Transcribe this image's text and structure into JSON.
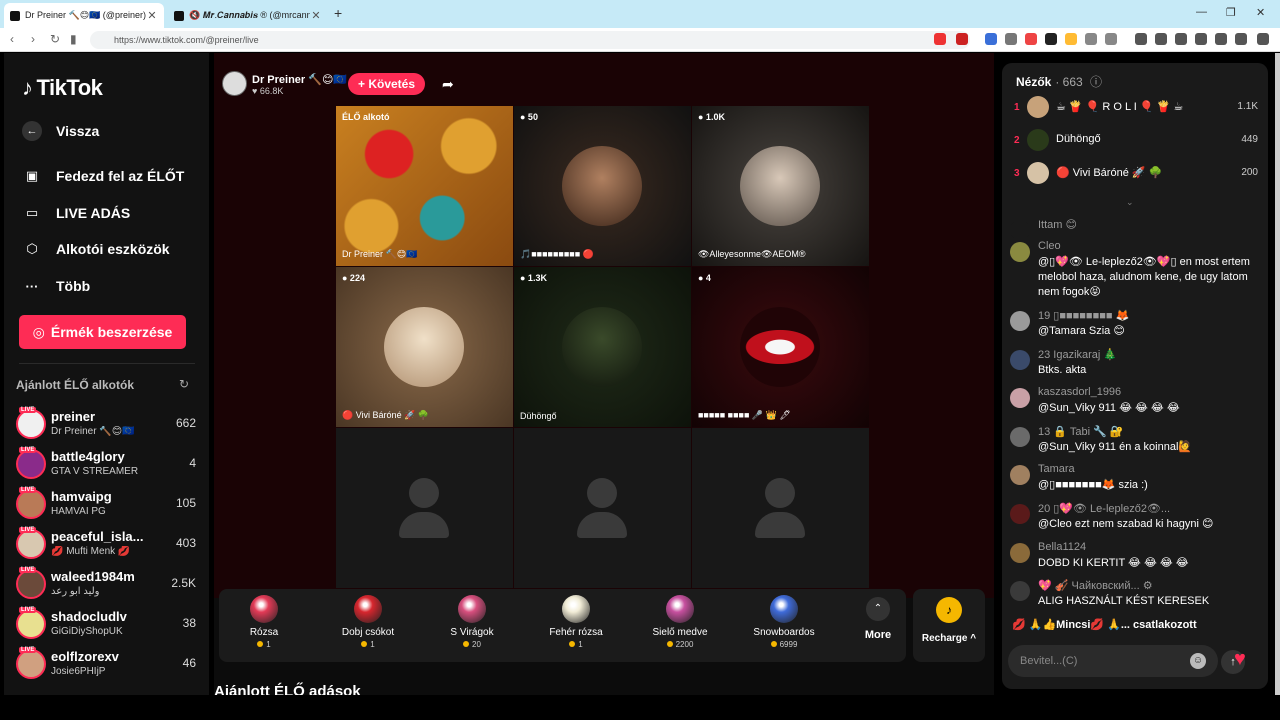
{
  "browser": {
    "tabs": [
      {
        "title": "Dr Preiner 🔨😊🇪🇺 (@preiner)"
      },
      {
        "title": "🔇 𝑴𝒓.𝑪𝒂𝒏𝒏𝒂𝒃𝒊𝒔 ® (@mrcannab"
      }
    ],
    "url": "https://www.tiktok.com/@preiner/live"
  },
  "sidebar": {
    "logo": "TikTok",
    "nav": [
      {
        "label": "Vissza"
      },
      {
        "label": "Fedezd fel az ÉLŐT"
      },
      {
        "label": "LIVE ADÁS"
      },
      {
        "label": "Alkotói eszközök"
      },
      {
        "label": "Több"
      }
    ],
    "coins_button": "Érmék beszerzése",
    "recommended_title": "Ajánlott ÉLŐ alkotók",
    "creators": [
      {
        "name": "preiner",
        "sub": "Dr Preiner 🔨😊🇪🇺",
        "count": "662",
        "color": "#f0f0f0"
      },
      {
        "name": "battle4glory",
        "sub": "GTA V STREAMER",
        "count": "4",
        "color": "#8a2b8a"
      },
      {
        "name": "hamvaipg",
        "sub": "HAMVAI PG",
        "count": "105",
        "color": "#b97a57"
      },
      {
        "name": "peaceful_isla...",
        "sub": "💋 Mufti Menk 💋",
        "count": "403",
        "color": "#d8c8b0"
      },
      {
        "name": "waleed1984m",
        "sub": "وليد ابو رعد",
        "count": "2.5K",
        "color": "#6b4a3a"
      },
      {
        "name": "shadocludlv",
        "sub": "GiGiDiyShopUK",
        "count": "38",
        "color": "#e8e090"
      },
      {
        "name": "eolflzorexv",
        "sub": "Josie6PHIjP",
        "count": "46",
        "color": "#d0a080"
      }
    ]
  },
  "host": {
    "name": "Dr Preiner 🔨😊🇪🇺",
    "likes": "♥ 66.8K",
    "follow_label": "+ Követés"
  },
  "grid": [
    {
      "badge": "ÉLŐ alkotó",
      "caption": "Dr Preiner 🔨😊🇪🇺"
    },
    {
      "badge": "● 50",
      "caption": "🎵■■■■■■■■■ 🔴"
    },
    {
      "badge": "● 1.0K",
      "caption": "👁Alleyesonme👁AEOM®"
    },
    {
      "badge": "● 224",
      "caption": "🔴 Vivi Báróné 🚀 🌳"
    },
    {
      "badge": "● 1.3K",
      "caption": "Dühöngő"
    },
    {
      "badge": "● 4",
      "caption": "■■■■■ ■■■■ 🎤 👑 🖊"
    }
  ],
  "gifts": [
    {
      "name": "Rózsa",
      "price": "1",
      "color": "#e23a56"
    },
    {
      "name": "Dobj csókot",
      "price": "1",
      "color": "#d7262e"
    },
    {
      "name": "S Virágok",
      "price": "20",
      "color": "#d74f7e"
    },
    {
      "name": "Fehér rózsa",
      "price": "1",
      "color": "#f1ecd6"
    },
    {
      "name": "Sielő medve",
      "price": "2200",
      "color": "#c7509f"
    },
    {
      "name": "Snowboardos",
      "price": "6999",
      "color": "#3f6bd9"
    }
  ],
  "more_label": "More",
  "recharge_label": "Recharge ^",
  "section_title": "Ajánlott ÉLŐ adások",
  "panel": {
    "viewers_label": "Nézők",
    "viewers_count": "· 663",
    "ranking": [
      {
        "no": "1",
        "name": "☕ 🍟 🎈 R O L I 🎈 🍟 ☕",
        "score": "1.1K",
        "color": "#c7a27a"
      },
      {
        "no": "2",
        "name": "Dühöngő",
        "score": "449",
        "color": "#2a3a1a"
      },
      {
        "no": "3",
        "name": "🔴 Vivi Báróné 🚀 🌳",
        "score": "200",
        "color": "#d6c2a6"
      }
    ],
    "messages": [
      {
        "user": "Ittam 😊",
        "text": "",
        "color": "#1a1a1a"
      },
      {
        "user": "Cleo",
        "text": "@▯💖👁 Le-leplező2👁💖▯ en most ertem melobol haza, aludnom kene, de ugy latom nem fogok😝",
        "color": "#8a8a40"
      },
      {
        "user": "19 ▯■■■■■■■■ 🦊",
        "text": "@Tamara Szia 😊",
        "color": "#9a9a9a"
      },
      {
        "user": "23 Igazikaraj 🎄",
        "text": "Btks. akta",
        "color": "#3a4a6a"
      },
      {
        "user": "kaszasdorl_1996",
        "text": "@Sun_Viky 911 😂 😂 😂 😂",
        "color": "#c9a0a6"
      },
      {
        "user": "13 🔒 Tabi 🔧 🔐",
        "text": "@Sun_Viky 911 én a koinnal🙋",
        "color": "#6a6a6a"
      },
      {
        "user": "Tamara",
        "text": "@▯■■■■■■■🦊 szia :)",
        "color": "#a08060"
      },
      {
        "user": "20 ▯💖👁 Le-leplező2👁...",
        "text": "@Cleo ezt nem szabad ki hagyni 😊",
        "color": "#5a1a1a"
      },
      {
        "user": "Bella1124",
        "text": "DOBD KI KERTIT 😂 😂 😂 😂",
        "color": "#8a6a3a"
      },
      {
        "user": "💖 🎻 Чайковский... ⚙",
        "text": "ALIG HASZNÁLT KÉST KERESEK",
        "color": "#3a3a3a"
      }
    ],
    "joined": "💋 🙏👍Mincsi💋 🙏...   csatlakozott",
    "input_placeholder": "Bevitel...(C)"
  }
}
